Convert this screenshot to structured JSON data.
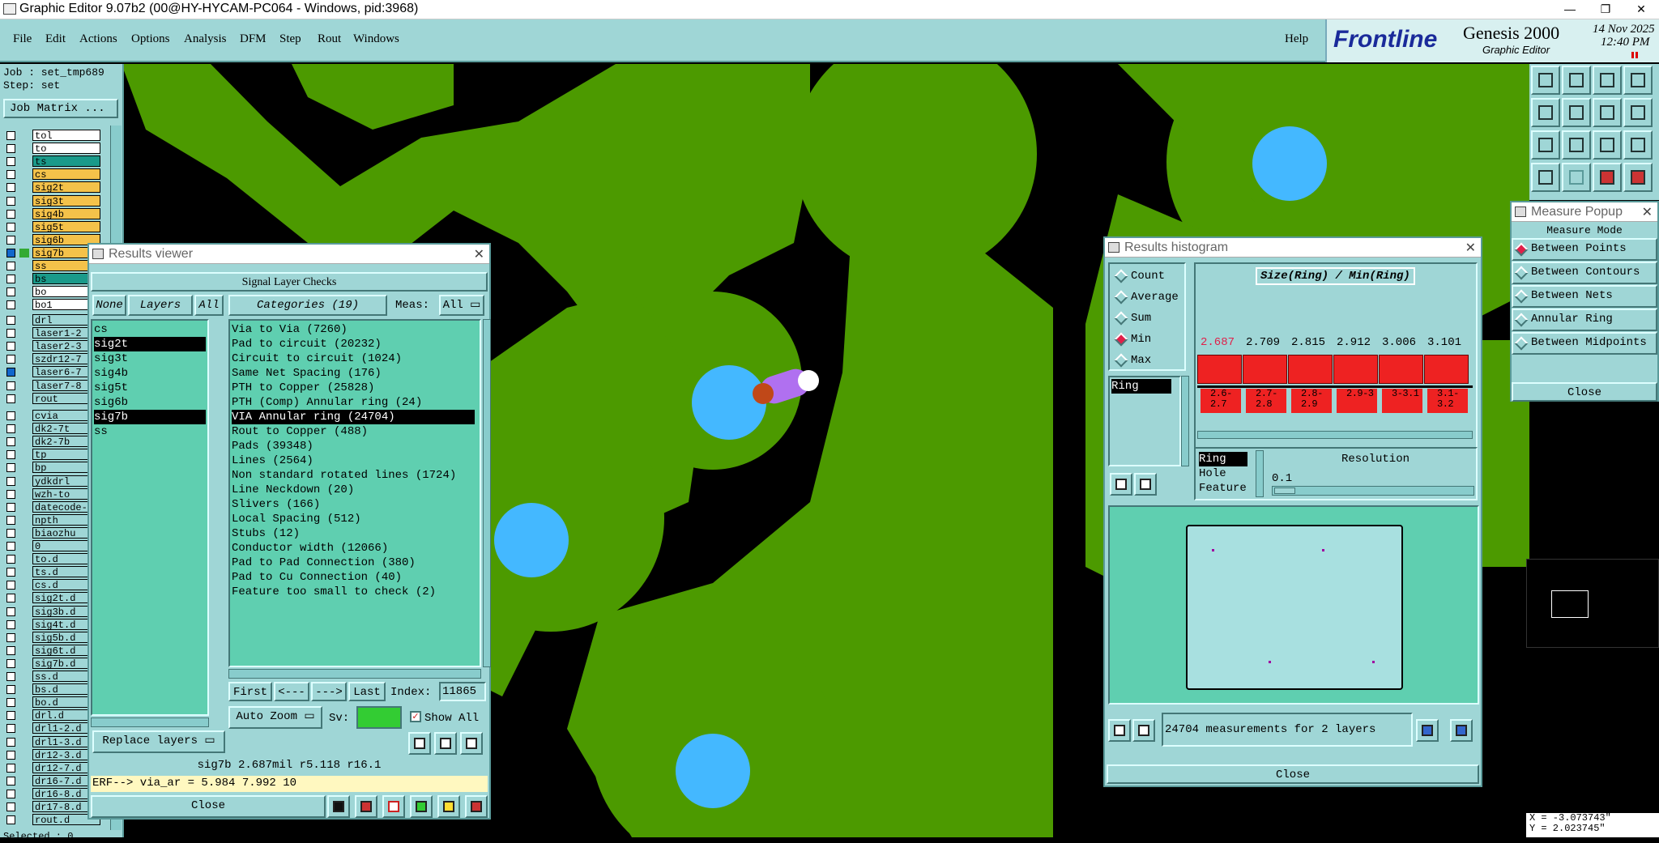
{
  "window": {
    "title": "Graphic Editor 9.07b2 (00@HY-HYCAM-PC064 - Windows, pid:3968)",
    "min": "—",
    "max": "❐",
    "close": "✕"
  },
  "menu": {
    "items": [
      "File",
      "Edit",
      "Actions",
      "Options",
      "Analysis",
      "DFM",
      "Step",
      "Rout",
      "Windows"
    ],
    "help": "Help"
  },
  "brand": {
    "logo": "Frontline",
    "product": "Genesis 2000",
    "sub": "Graphic Editor",
    "date": "14 Nov 2025",
    "time": "12:40 PM"
  },
  "left": {
    "job": "Job : set_tmp689",
    "step": "Step: set",
    "job_matrix": "Job Matrix ...",
    "layers_top": [
      {
        "name": "tol",
        "bg": "#ffffff"
      },
      {
        "name": "to",
        "bg": "#ffffff"
      },
      {
        "name": "ts",
        "bg": "#1a9a8a"
      },
      {
        "name": "cs",
        "bg": "#f4c24a"
      },
      {
        "name": "sig2t",
        "bg": "#f4c24a"
      },
      {
        "name": "sig3t",
        "bg": "#f4c24a"
      },
      {
        "name": "sig4b",
        "bg": "#f4c24a"
      },
      {
        "name": "sig5t",
        "bg": "#f4c24a"
      },
      {
        "name": "sig6b",
        "bg": "#f4c24a"
      },
      {
        "name": "sig7b",
        "bg": "#f4c24a"
      },
      {
        "name": "ss",
        "bg": "#f4c24a"
      },
      {
        "name": "bs",
        "bg": "#1a9a8a"
      },
      {
        "name": "bo",
        "bg": "#ffffff"
      },
      {
        "name": "bo1",
        "bg": "#ffffff"
      }
    ],
    "layers_mid": [
      "drl",
      "laser1-2",
      "laser2-3",
      "szdr12-7",
      "laser6-7",
      "laser7-8",
      "rout"
    ],
    "layers_bot": [
      "cvia",
      "dk2-7t",
      "dk2-7b",
      "tp",
      "bp",
      "ydkdrl",
      "wzh-to",
      "datecode-t",
      "npth",
      "biaozhu",
      "0",
      "to.d",
      "ts.d",
      "cs.d",
      "sig2t.d",
      "sig3b.d",
      "sig4t.d",
      "sig5b.d",
      "sig6t.d",
      "sig7b.d",
      "ss.d",
      "bs.d",
      "bo.d",
      "drl.d",
      "drl1-2.d",
      "drl1-3.d",
      "dr12-3.d",
      "dr12-7.d",
      "dr16-7.d",
      "dr16-8.d",
      "dr17-8.d",
      "rout.d"
    ],
    "selected": "Selected : 0"
  },
  "results_viewer": {
    "title": "Results viewer",
    "header": "Signal Layer Checks",
    "btn_none": "None",
    "btn_layers": "Layers",
    "btn_all": "All",
    "categories_label": "Categories (19)",
    "meas_label": "Meas:",
    "meas_value": "All",
    "layers": [
      "cs",
      "sig2t",
      "sig3t",
      "sig4b",
      "sig5t",
      "sig6b",
      "sig7b",
      "ss"
    ],
    "categories": [
      "Via to Via (7260)",
      "Pad to circuit (20232)",
      "Circuit to circuit (1024)",
      "Same Net Spacing (176)",
      "PTH to Copper (25828)",
      "PTH (Comp) Annular ring (24)",
      "VIA Annular ring (24704)",
      "Rout to Copper (488)",
      "Pads (39348)",
      "Lines (2564)",
      "Non standard rotated lines (1724)",
      "Line Neckdown (20)",
      "Slivers (166)",
      "Local Spacing (512)",
      "Stubs (12)",
      "Conductor width (12066)",
      "Pad to Pad Connection (380)",
      "Pad to Cu Connection (40)",
      "Feature too small to check (2)"
    ],
    "nav": {
      "first": "First",
      "prev": "<---",
      "next": "--->",
      "last": "Last",
      "index_label": "Index:",
      "index_value": "11865"
    },
    "replace": "Replace layers",
    "auto_zoom": "Auto Zoom",
    "sv": "Sv:",
    "show_all": "Show All",
    "status": "sig7b 2.687mil   r5.118   r16.1",
    "erf": "ERF--> via_ar = 5.984 7.992 10",
    "close": "Close"
  },
  "histogram": {
    "title": "Results histogram",
    "modes": [
      "Count",
      "Average",
      "Sum",
      "Min",
      "Max"
    ],
    "mode_selected": "Min",
    "chart_title": "Size(Ring) / Min(Ring)",
    "list_item": "Ring",
    "values": [
      "2.687",
      "2.709",
      "2.815",
      "2.912",
      "3.006",
      "3.101"
    ],
    "bins": [
      "2.6-2.7",
      "2.7-2.8",
      "2.8-2.9",
      "2.9-3",
      "3-3.1",
      "3.1-3.2"
    ],
    "types": [
      "Ring",
      "Hole",
      "Feature"
    ],
    "resolution_label": "Resolution",
    "resolution_value": "0.1",
    "status": "24704 measurements for 2 layers",
    "close": "Close"
  },
  "measure": {
    "title": "Measure Popup",
    "mode_label": "Measure Mode",
    "items": [
      "Between Points",
      "Between Contours",
      "Between Nets",
      "Annular Ring",
      "Between Midpoints"
    ],
    "close": "Close"
  },
  "coords": {
    "x": "X = -3.073743\"",
    "y": "Y = 2.023745\""
  },
  "colors": {
    "panel": "#9fd6d6",
    "copper": "#4c9a00",
    "via": "#44b8ff",
    "accent": "#e0204a"
  }
}
